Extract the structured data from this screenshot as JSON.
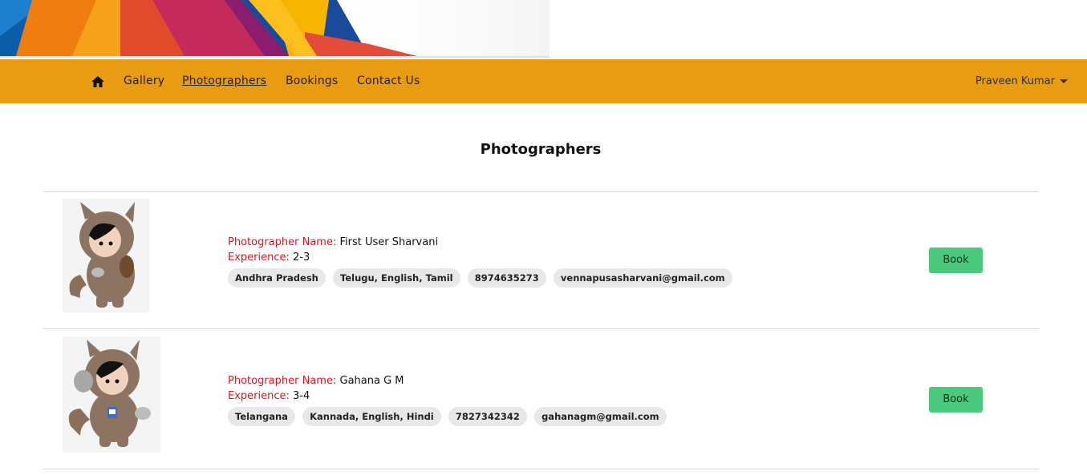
{
  "nav": {
    "home_icon": "home-icon",
    "links": [
      {
        "label": "Gallery",
        "active": false
      },
      {
        "label": "Photographers",
        "active": true
      },
      {
        "label": "Bookings",
        "active": false
      },
      {
        "label": "Contact Us",
        "active": false
      }
    ],
    "user_name": "Praveen Kumar",
    "bar_color": "#e89c13"
  },
  "page": {
    "title": "Photographers"
  },
  "labels": {
    "name": "Photographer Name:",
    "experience": "Experience:",
    "book": "Book",
    "label_color": "#e0141c",
    "button_color": "#4bc97d"
  },
  "photographers": [
    {
      "name": "First User Sharvani",
      "experience": "2-3",
      "state": "Andhra Pradesh",
      "languages": "Telugu, English, Tamil",
      "phone": "8974635273",
      "email": "vennapusasharvani@gmail.com"
    },
    {
      "name": "Gahana G M",
      "experience": "3-4",
      "state": "Telangana",
      "languages": "Kannada, English, Hindi",
      "phone": "7827342342",
      "email": "gahanagm@gmail.com"
    }
  ]
}
